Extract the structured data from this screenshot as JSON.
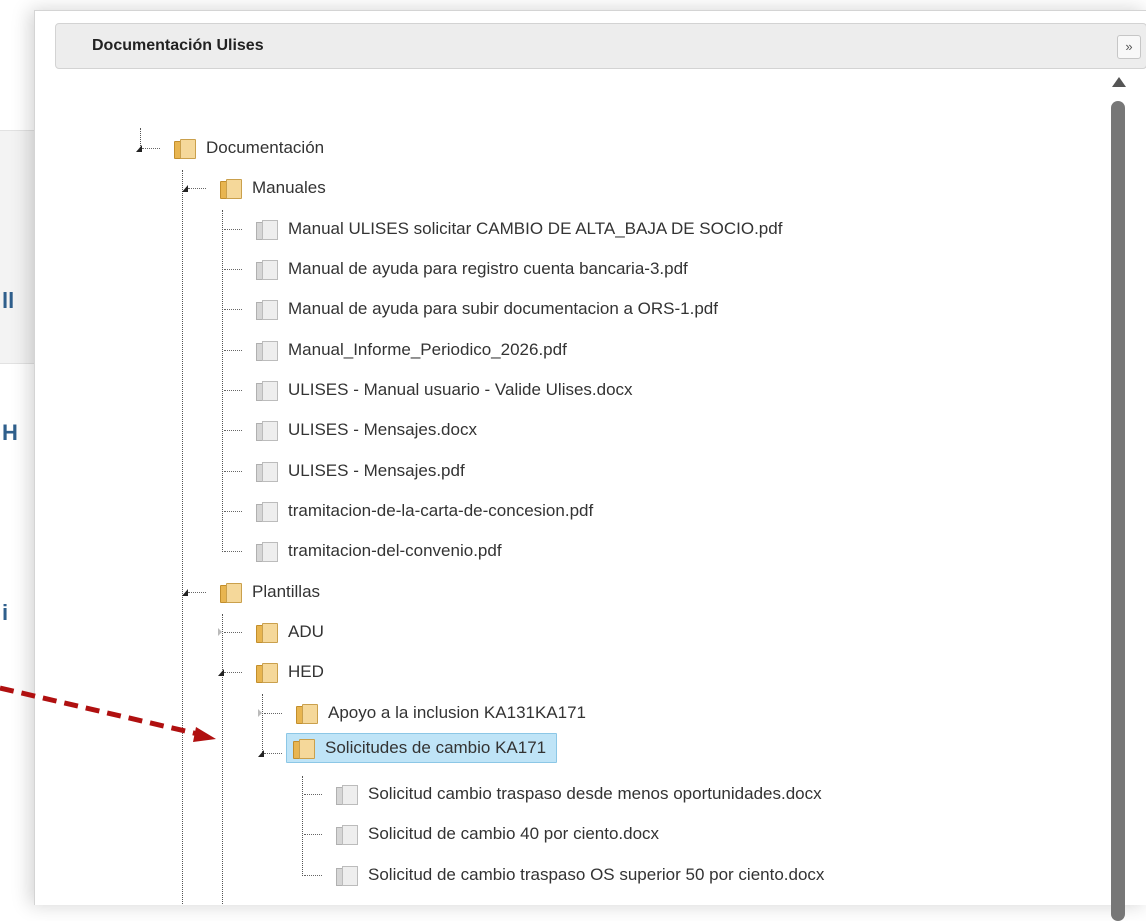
{
  "dialog": {
    "title": "Documentación Ulises",
    "close_glyph": "»"
  },
  "tree": [
    {
      "label": "Documentación",
      "type": "folder",
      "state": "expanded"
    },
    {
      "label": "Manuales",
      "type": "folder",
      "state": "expanded"
    },
    {
      "label": "Manual ULISES solicitar CAMBIO DE ALTA_BAJA DE SOCIO.pdf",
      "type": "file"
    },
    {
      "label": "Manual de ayuda para registro cuenta bancaria-3.pdf",
      "type": "file"
    },
    {
      "label": "Manual de ayuda para subir documentacion a ORS-1.pdf",
      "type": "file"
    },
    {
      "label": "Manual_Informe_Periodico_2026.pdf",
      "type": "file"
    },
    {
      "label": "ULISES - Manual usuario - Valide Ulises.docx",
      "type": "file"
    },
    {
      "label": "ULISES - Mensajes.docx",
      "type": "file"
    },
    {
      "label": "ULISES - Mensajes.pdf",
      "type": "file"
    },
    {
      "label": "tramitacion-de-la-carta-de-concesion.pdf",
      "type": "file"
    },
    {
      "label": "tramitacion-del-convenio.pdf",
      "type": "file"
    },
    {
      "label": "Plantillas",
      "type": "folder",
      "state": "expanded"
    },
    {
      "label": "ADU",
      "type": "folder",
      "state": "collapsed"
    },
    {
      "label": "HED",
      "type": "folder",
      "state": "expanded"
    },
    {
      "label": "Apoyo a la inclusion KA131KA171",
      "type": "folder",
      "state": "collapsed"
    },
    {
      "label": "Solicitudes de cambio KA171",
      "type": "folder",
      "state": "expanded",
      "selected": true
    },
    {
      "label": "Solicitud cambio traspaso desde menos oportunidades.docx",
      "type": "file"
    },
    {
      "label": "Solicitud de cambio 40 por ciento.docx",
      "type": "file"
    },
    {
      "label": "Solicitud de cambio traspaso OS superior 50 por ciento.docx",
      "type": "file"
    }
  ],
  "background": {
    "fragments": [
      "ll",
      "H",
      "i"
    ]
  },
  "colors": {
    "selection": "#bfe4f7",
    "annotation_arrow": "#b01010",
    "folder": "#e8b550"
  }
}
